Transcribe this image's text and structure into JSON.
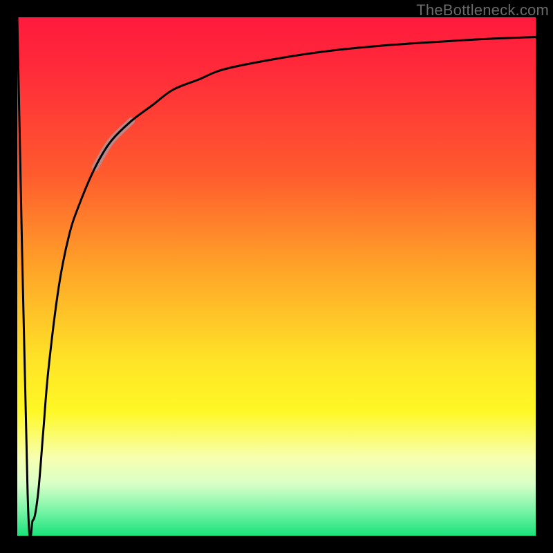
{
  "watermark": "TheBottleneck.com",
  "colors": {
    "frame": "#000000",
    "gradient_top": "#ff1a3c",
    "gradient_mid": "#ffe327",
    "gradient_bottom": "#19e37a",
    "curve": "#000000",
    "highlight": "#bb8a8c"
  },
  "chart_data": {
    "type": "line",
    "title": "",
    "xlabel": "",
    "ylabel": "",
    "xlim": [
      0,
      100
    ],
    "ylim": [
      0,
      100
    ],
    "series": [
      {
        "name": "bottleneck-curve",
        "x": [
          0,
          2,
          3,
          4,
          5,
          6,
          8,
          10,
          12,
          15,
          18,
          22,
          26,
          30,
          35,
          40,
          50,
          60,
          70,
          80,
          90,
          100
        ],
        "values": [
          100,
          8,
          3,
          8,
          20,
          32,
          48,
          58,
          64,
          71,
          76,
          80,
          83,
          86,
          88,
          90,
          92,
          93.5,
          94.5,
          95.2,
          95.8,
          96.2
        ]
      }
    ],
    "annotations": [
      {
        "name": "highlight-segment",
        "x_range": [
          15,
          22
        ],
        "note": "thick muted-pink segment on rising branch"
      }
    ],
    "background": "vertical rainbow gradient red→green",
    "grid": false,
    "legend": false
  }
}
